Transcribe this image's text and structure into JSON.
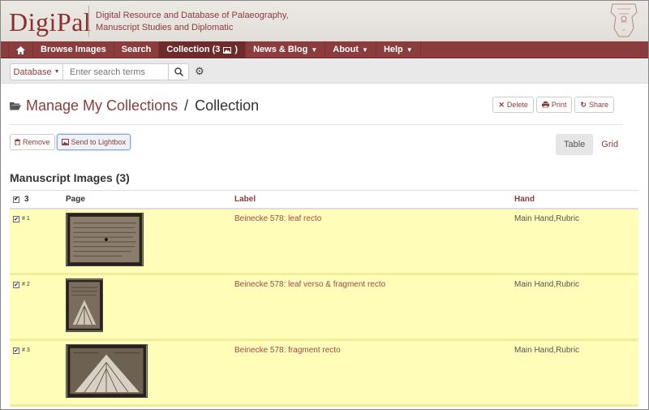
{
  "header": {
    "brand": "DigiPal",
    "tagline_line1": "Digital Resource and Database of Palaeography,",
    "tagline_line2": "Manuscript Studies and Diplomatic"
  },
  "nav": {
    "home_icon": "home-icon",
    "items": [
      {
        "label": "Browse Images"
      },
      {
        "label": "Search"
      },
      {
        "label": "Collection (3",
        "suffix": ")",
        "icon": "image-icon",
        "active": true
      },
      {
        "label": "News & Blog",
        "caret": true
      },
      {
        "label": "About",
        "caret": true
      },
      {
        "label": "Help",
        "caret": true
      }
    ]
  },
  "search": {
    "database_label": "Database",
    "placeholder": "Enter search terms"
  },
  "page": {
    "breadcrumb_link": "Manage My Collections",
    "breadcrumb_sep": "/",
    "breadcrumb_current": "Collection",
    "actions": {
      "delete": "Delete",
      "print": "Print",
      "share": "Share"
    },
    "toolbar": {
      "remove": "Remove",
      "send_lightbox": "Send to Lightbox"
    },
    "views": {
      "table": "Table",
      "grid": "Grid",
      "active": "table"
    },
    "section_title": "Manuscript Images (3)"
  },
  "table": {
    "count": "3",
    "headers": {
      "page": "Page",
      "label": "Label",
      "hand": "Hand"
    },
    "rows": [
      {
        "index": "# 1",
        "label": "Beinecke 578: leaf recto",
        "hand": "Main Hand,Rubric",
        "checked": true
      },
      {
        "index": "# 2",
        "label": "Beinecke 578: leaf verso & fragment recto",
        "hand": "Main Hand,Rubric",
        "checked": true
      },
      {
        "index": "# 3",
        "label": "Beinecke 578: fragment recto",
        "hand": "Main Hand,Rubric",
        "checked": true
      }
    ]
  },
  "colors": {
    "brand": "#8b3c3c",
    "row_highlight": "#fffdb8",
    "nav_bg": "#8b3c3c"
  }
}
